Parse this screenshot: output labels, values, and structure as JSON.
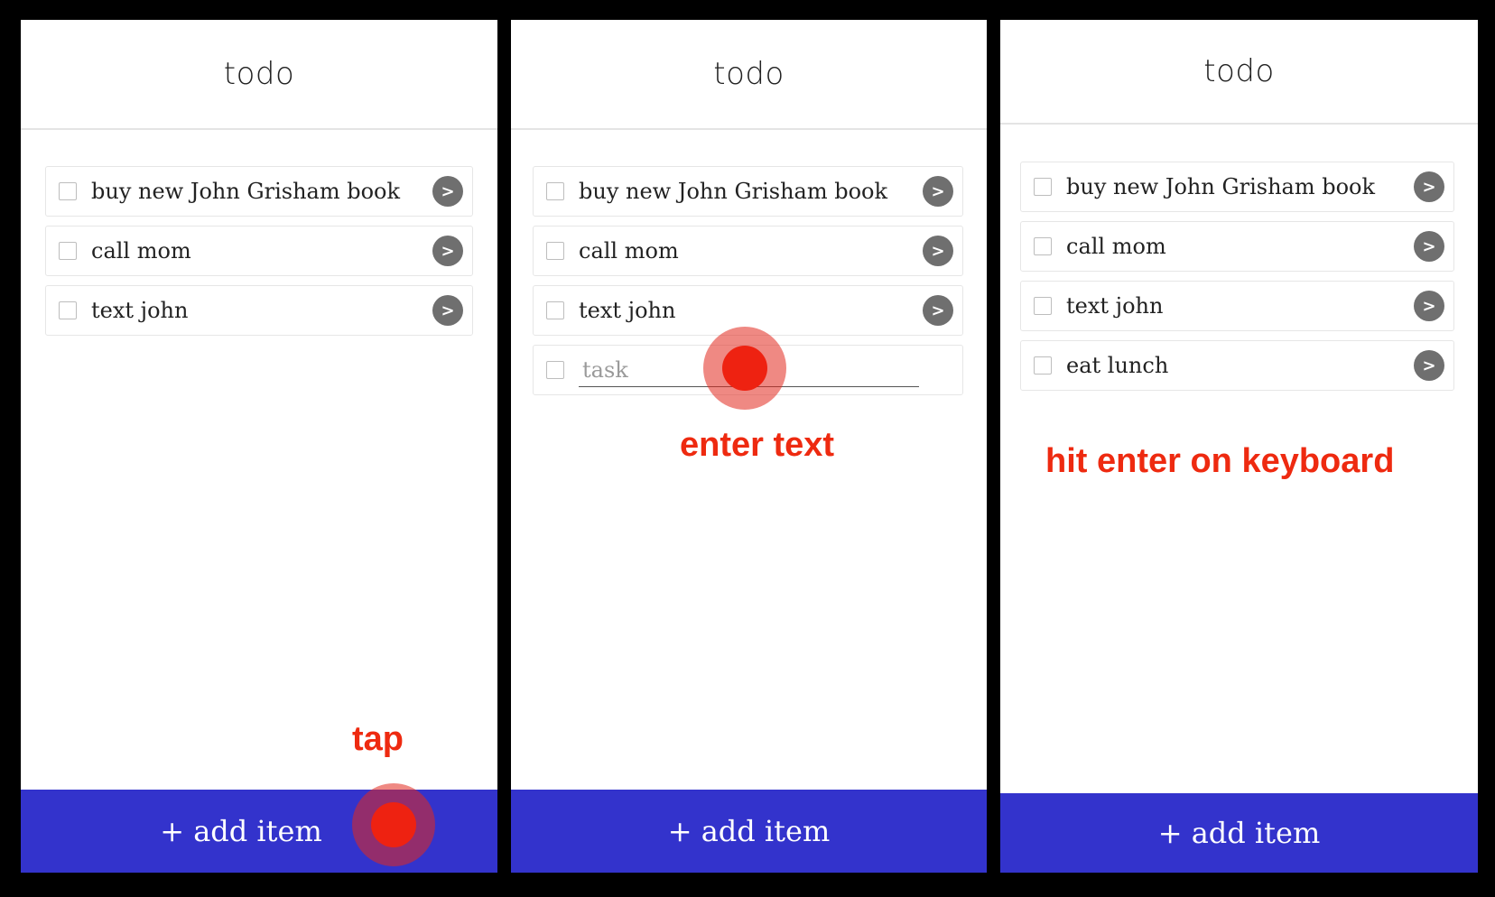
{
  "screens": [
    {
      "title": "todo",
      "items": [
        {
          "text": "buy new John Grisham book",
          "arrow": ">"
        },
        {
          "text": "call mom",
          "arrow": ">"
        },
        {
          "text": "text john",
          "arrow": ">"
        }
      ],
      "footer_label": "+ add item",
      "annotation": "tap"
    },
    {
      "title": "todo",
      "items": [
        {
          "text": "buy new John Grisham book",
          "arrow": ">"
        },
        {
          "text": "call mom",
          "arrow": ">"
        },
        {
          "text": "text john",
          "arrow": ">"
        }
      ],
      "new_task_placeholder": "task",
      "footer_label": "+ add item",
      "annotation": "enter text"
    },
    {
      "title": "todo",
      "items": [
        {
          "text": "buy new John Grisham book",
          "arrow": ">"
        },
        {
          "text": "call mom",
          "arrow": ">"
        },
        {
          "text": "text john",
          "arrow": ">"
        },
        {
          "text": "eat lunch",
          "arrow": ">"
        }
      ],
      "footer_label": "+ add item",
      "annotation": "hit enter on keyboard"
    }
  ],
  "colors": {
    "footer_bg": "#3333cc",
    "annotation": "#ee2a10",
    "arrow_button": "#6f6f6f"
  },
  "icons": {
    "item_checkbox": "checkbox-icon",
    "item_arrow": "chevron-right-icon",
    "tap_marker": "tap-indicator-icon"
  }
}
